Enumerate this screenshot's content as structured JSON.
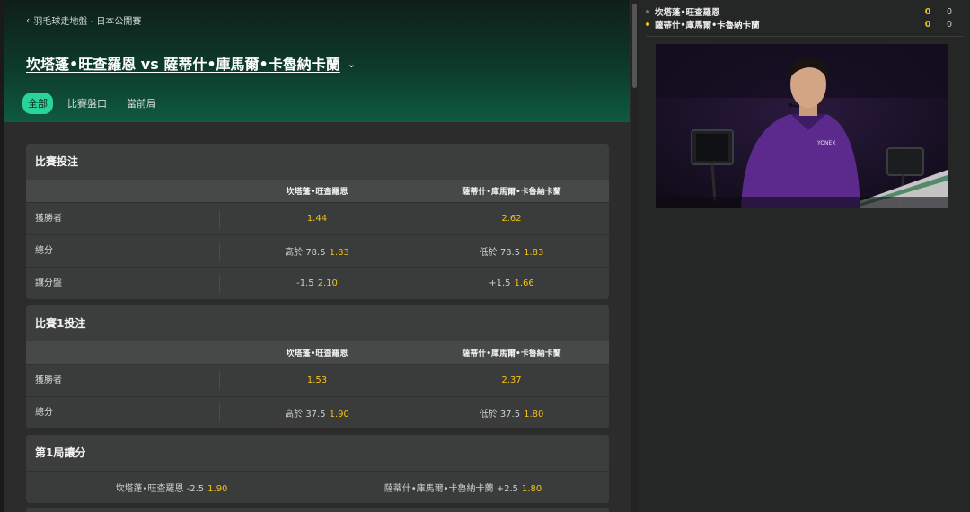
{
  "breadcrumb": {
    "back_icon": "chevron-left-icon",
    "text": "羽毛球走地盤 - 日本公開賽"
  },
  "match": {
    "title": "坎塔蓬•旺查羅恩 vs 薩蒂什•庫馬爾•卡魯納卡蘭",
    "dropdown_icon": "chevron-down-icon"
  },
  "tabs": [
    {
      "label": "全部",
      "active": true
    },
    {
      "label": "比賽盤口",
      "active": false
    },
    {
      "label": "當前局",
      "active": false
    }
  ],
  "markets": {
    "match_bet": {
      "title": "比賽投注",
      "headers": [
        "",
        "坎塔蓬•旺查羅恩",
        "薩蒂什•庫馬爾•卡魯納卡蘭"
      ],
      "rows": [
        {
          "label": "獲勝者",
          "a_line": "",
          "a_odd": "1.44",
          "b_line": "",
          "b_odd": "2.62"
        },
        {
          "label": "總分",
          "a_line": "高於 78.5",
          "a_odd": "1.83",
          "b_line": "低於 78.5",
          "b_odd": "1.83"
        },
        {
          "label": "讓分盤",
          "a_line": "-1.5",
          "a_odd": "2.10",
          "b_line": "+1.5",
          "b_odd": "1.66"
        }
      ]
    },
    "game1_bet": {
      "title": "比賽1投注",
      "headers": [
        "",
        "坎塔蓬•旺查羅恩",
        "薩蒂什•庫馬爾•卡魯納卡蘭"
      ],
      "rows": [
        {
          "label": "獲勝者",
          "a_line": "",
          "a_odd": "1.53",
          "b_line": "",
          "b_odd": "2.37"
        },
        {
          "label": "總分",
          "a_line": "高於 37.5",
          "a_odd": "1.90",
          "b_line": "低於 37.5",
          "b_odd": "1.80"
        }
      ]
    },
    "set1_handicap": {
      "title": "第1局讓分",
      "a_line": "坎塔蓬•旺查羅恩 -2.5",
      "a_odd": "1.90",
      "b_line": "薩蒂什•庫馬爾•卡魯納卡蘭 +2.5",
      "b_odd": "1.80"
    }
  },
  "scoreboard": {
    "players": [
      {
        "name": "坎塔蓬•旺查羅恩",
        "serving": false,
        "games": "0",
        "points": "0"
      },
      {
        "name": "薩蒂什•庫馬爾•卡魯納卡蘭",
        "serving": true,
        "games": "0",
        "points": "0"
      }
    ]
  },
  "video": {
    "description_icon": "live-video-stream"
  },
  "colors": {
    "accent": "#2ad39a",
    "odds": "#f3c319",
    "hero_green": "#0f5a40",
    "card": "#3a3b3b"
  }
}
